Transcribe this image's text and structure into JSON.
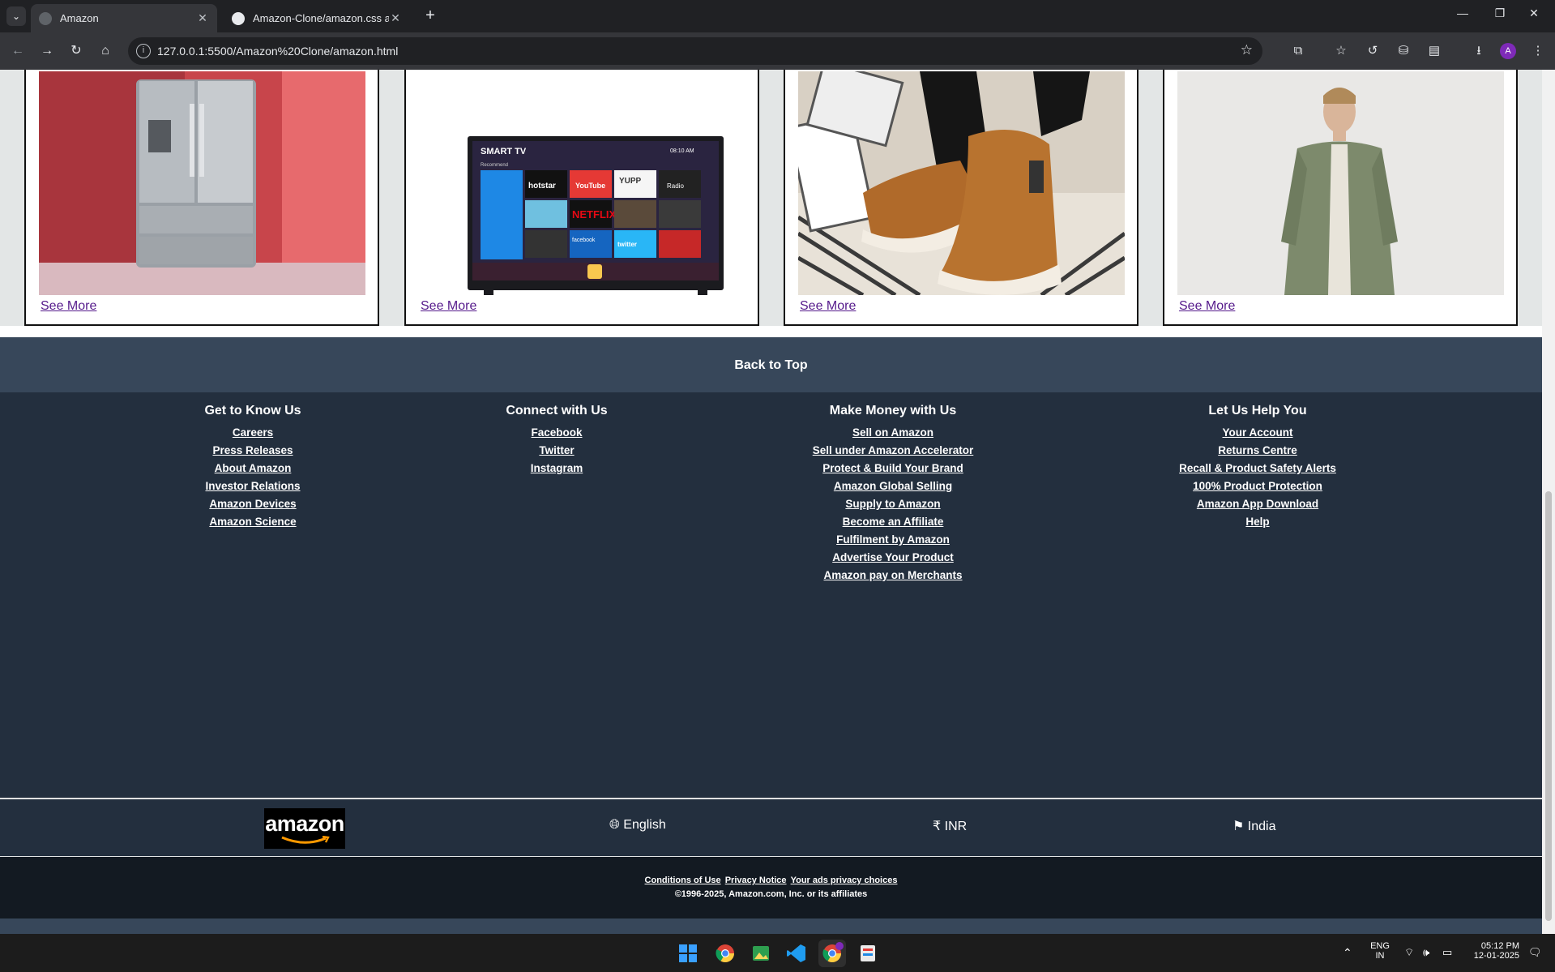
{
  "browser": {
    "tabs": [
      {
        "title": "Amazon",
        "active": true
      },
      {
        "title": "Amazon-Clone/amazon.css at m",
        "active": false
      }
    ],
    "url": "127.0.0.1:5500/Amazon%20Clone/amazon.html",
    "profile_initial": "A"
  },
  "cards": [
    {
      "link": "See More",
      "image": "refrigerator"
    },
    {
      "link": "See More",
      "image": "smart-tv"
    },
    {
      "link": "See More",
      "image": "boots"
    },
    {
      "link": "See More",
      "image": "man-jacket"
    }
  ],
  "tv": {
    "brand": "SMART TV",
    "time": "08:10 AM",
    "label": "Recommend",
    "apps": [
      "hotstar",
      "YouTube",
      "YUPP",
      "Radio",
      "NETFLIX",
      "facebook",
      "twitter"
    ]
  },
  "back_to_top": "Back to Top",
  "footer": {
    "columns": [
      {
        "heading": "Get to Know Us",
        "links": [
          "Careers",
          "Press Releases",
          "About Amazon",
          "Investor Relations",
          "Amazon Devices",
          "Amazon Science"
        ]
      },
      {
        "heading": "Connect with Us",
        "links": [
          "Facebook",
          "Twitter",
          "Instagram"
        ]
      },
      {
        "heading": "Make Money with Us",
        "links": [
          "Sell on Amazon",
          "Sell under Amazon Accelerator",
          "Protect & Build Your Brand",
          "Amazon Global Selling",
          "Supply to Amazon",
          "Become an Affiliate",
          "Fulfilment by Amazon",
          "Advertise Your Product",
          "Amazon pay on Merchants"
        ]
      },
      {
        "heading": "Let Us Help You",
        "links": [
          "Your Account",
          "Returns Centre",
          "Recall & Product Safety Alerts",
          "100% Product Protection",
          "Amazon App Download",
          "Help"
        ]
      }
    ],
    "logo_text": "amazon",
    "language": "English",
    "currency": "INR",
    "country": "India",
    "bottom_links": [
      "Conditions of Use",
      "Privacy Notice",
      "Your ads privacy choices"
    ],
    "copyright": "©1996-2025, Amazon.com, Inc. or its affiliates"
  },
  "taskbar": {
    "lang_top": "ENG",
    "lang_bottom": "IN",
    "time": "05:12 PM",
    "date": "12-01-2025"
  }
}
